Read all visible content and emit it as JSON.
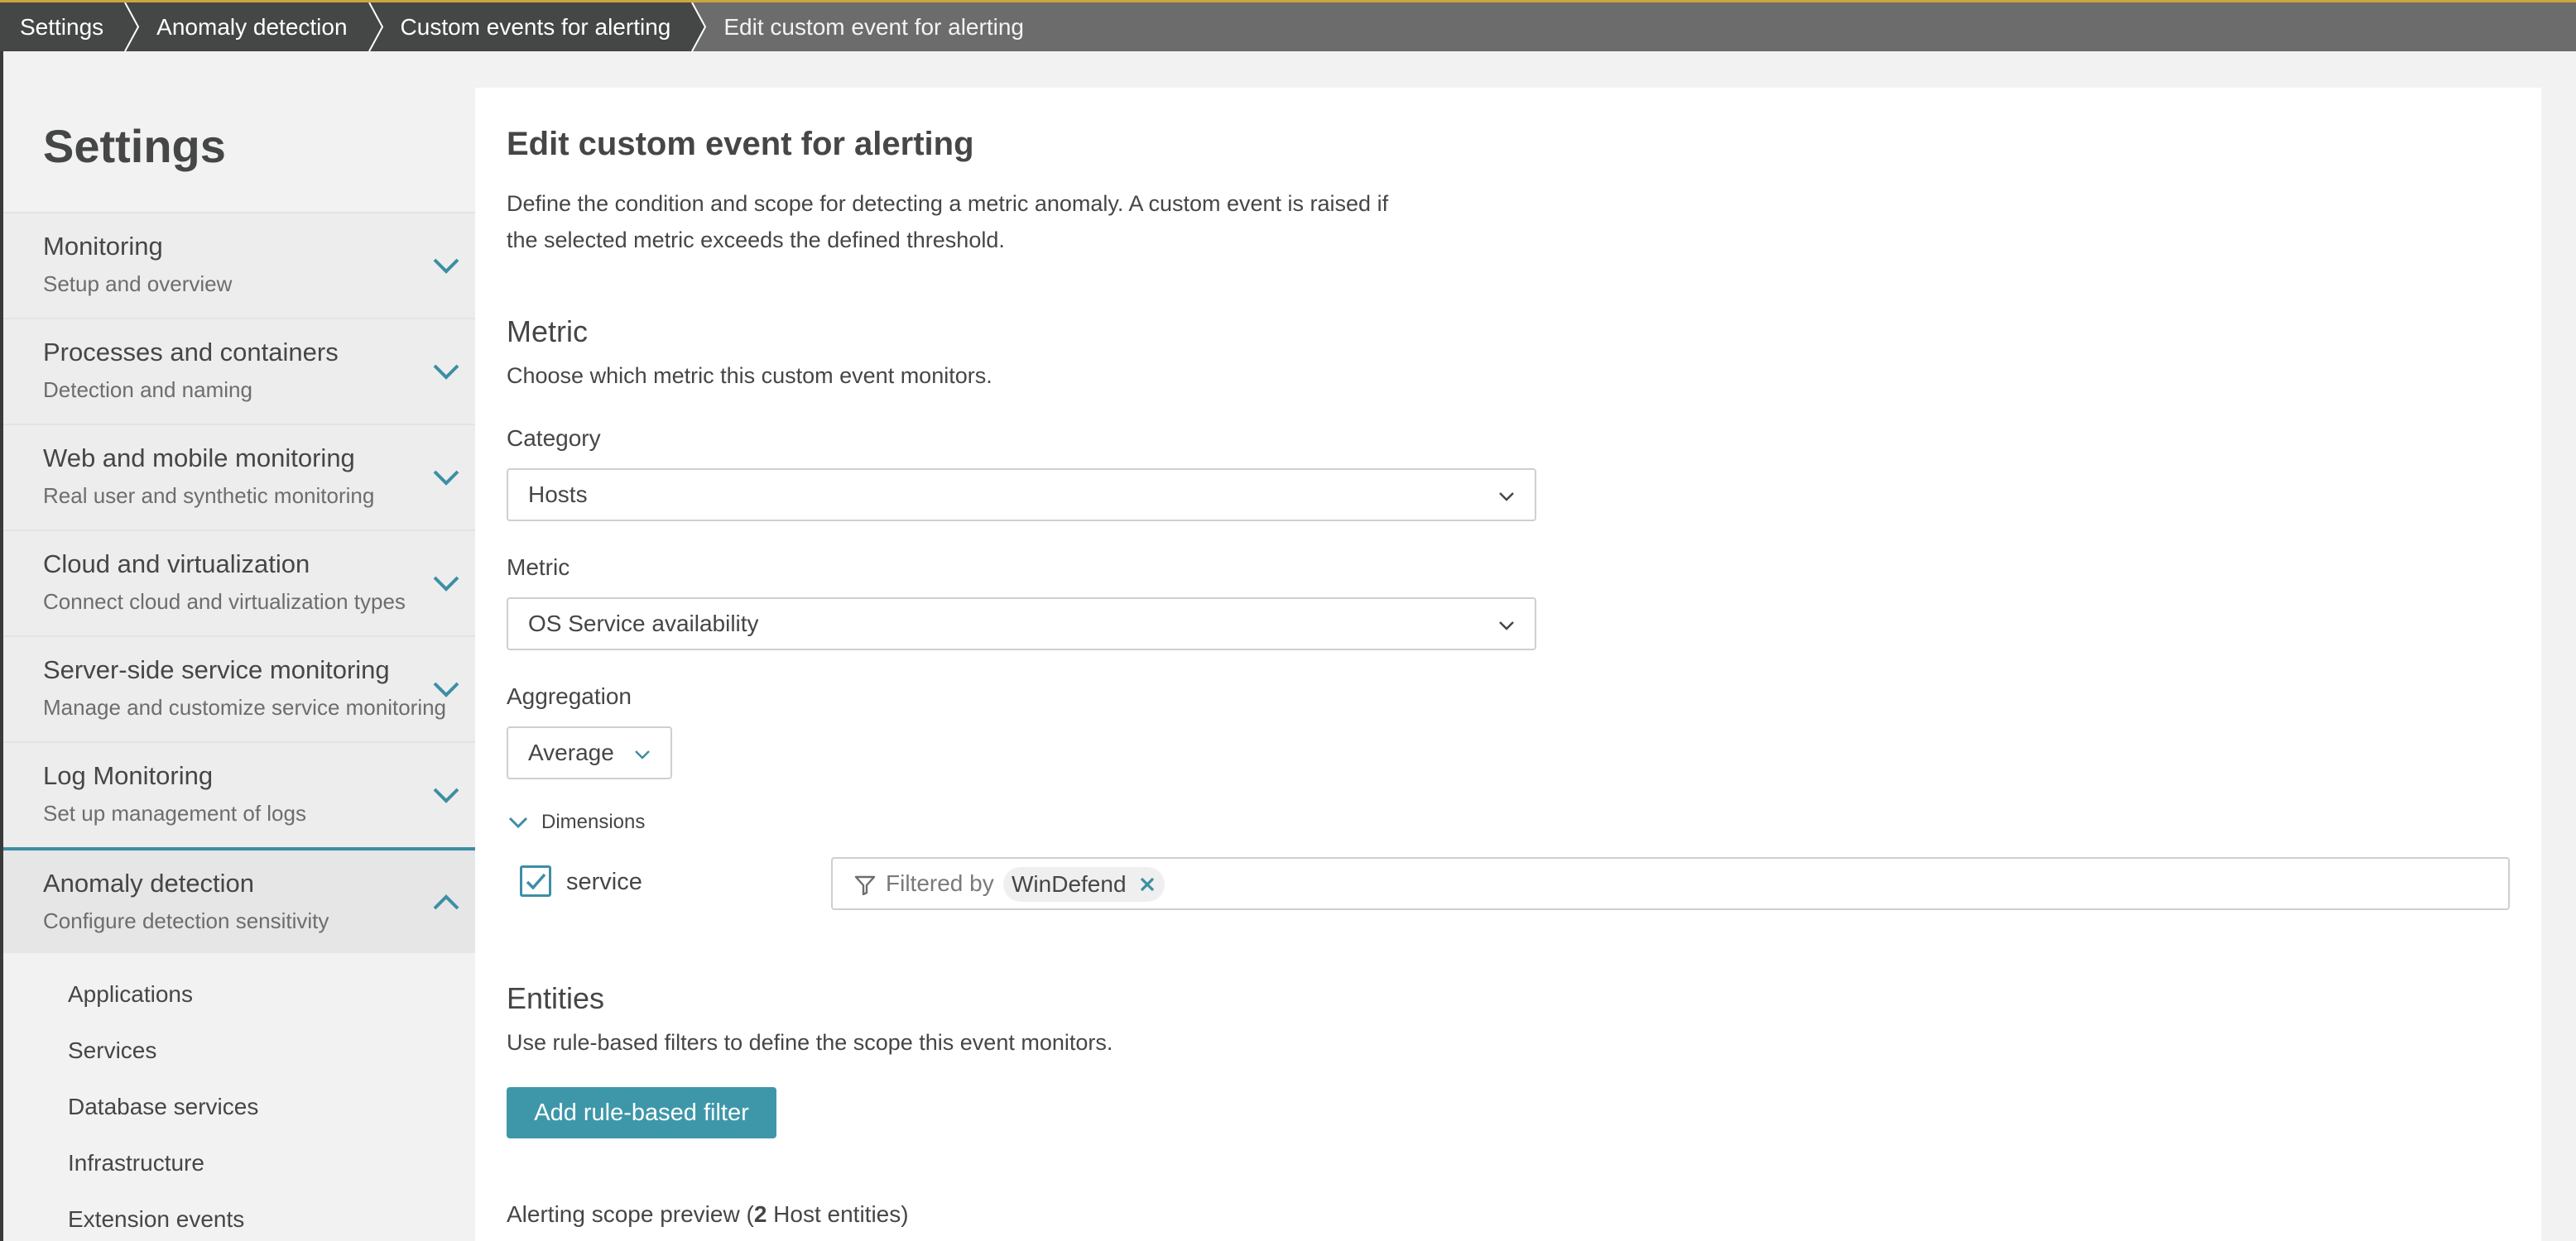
{
  "breadcrumb": {
    "items": [
      {
        "label": "Settings"
      },
      {
        "label": "Anomaly detection"
      },
      {
        "label": "Custom events for alerting"
      },
      {
        "label": "Edit custom event for alerting"
      }
    ]
  },
  "sidebar": {
    "title": "Settings",
    "sections": [
      {
        "label": "Monitoring",
        "sub": "Setup and overview"
      },
      {
        "label": "Processes and containers",
        "sub": "Detection and naming"
      },
      {
        "label": "Web and mobile monitoring",
        "sub": "Real user and synthetic monitoring"
      },
      {
        "label": "Cloud and virtualization",
        "sub": "Connect cloud and virtualization types"
      },
      {
        "label": "Server-side service monitoring",
        "sub": "Manage and customize service monitoring"
      },
      {
        "label": "Log Monitoring",
        "sub": "Set up management of logs"
      },
      {
        "label": "Anomaly detection",
        "sub": "Configure detection sensitivity"
      }
    ],
    "subitems": [
      {
        "label": "Applications"
      },
      {
        "label": "Services"
      },
      {
        "label": "Database services"
      },
      {
        "label": "Infrastructure"
      },
      {
        "label": "Extension events"
      }
    ]
  },
  "main": {
    "title": "Edit custom event for alerting",
    "description_line1": "Define the condition and scope for detecting a metric anomaly. A custom event is raised if",
    "description_line2": "the selected metric exceeds the defined threshold.",
    "metric_section": {
      "heading": "Metric",
      "description": "Choose which metric this custom event monitors."
    },
    "category": {
      "label": "Category",
      "value": "Hosts"
    },
    "metric": {
      "label": "Metric",
      "value": "OS Service availability"
    },
    "aggregation": {
      "label": "Aggregation",
      "value": "Average"
    },
    "dimensions": {
      "label": "Dimensions",
      "row": {
        "name": "service",
        "checked": true,
        "filter_prefix": "Filtered by",
        "filter_value": "WinDefend"
      }
    },
    "entities": {
      "heading": "Entities",
      "description": "Use rule-based filters to define the scope this event monitors.",
      "add_button": "Add rule-based filter"
    },
    "preview": {
      "prefix": "Alerting scope preview (",
      "count": "2",
      "suffix": " Host entities)"
    }
  },
  "colors": {
    "accent": "#3d8ea5",
    "button": "#3e97a9",
    "topbar": "#6c6c6c",
    "breadcrumb_dark": "#454646"
  }
}
